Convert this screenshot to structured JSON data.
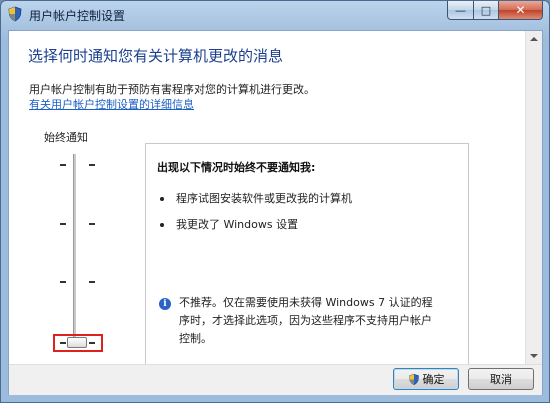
{
  "window": {
    "title": "用户帐户控制设置",
    "controls": {
      "minimize": "—",
      "maximize": "□",
      "close": "✕"
    }
  },
  "header": {
    "heading": "选择何时通知您有关计算机更改的消息",
    "description": "用户帐户控制有助于预防有害程序对您的计算机进行更改。",
    "link": "有关用户帐户控制设置的详细信息"
  },
  "slider": {
    "top_label": "始终通知",
    "level": 0,
    "levels_count": 4
  },
  "panel": {
    "title": "出现以下情况时始终不要通知我:",
    "bullets": [
      "程序试图安装软件或更改我的计算机",
      "我更改了 Windows 设置"
    ],
    "info_line1": "不推荐。仅在需要使用未获得 Windows 7 认证的程",
    "info_line2": "序时，才选择此选项，因为这些程序不支持用户帐户",
    "info_line3": "控制。"
  },
  "footer": {
    "ok_label": "确定",
    "cancel_label": "取消"
  },
  "icons": {
    "title_icon": "uac-shield-icon",
    "ok_icon": "uac-shield-icon",
    "info_icon": "info-icon"
  },
  "colors": {
    "heading": "#1a3f8f",
    "link": "#1c5fc4",
    "highlight": "#e02020"
  }
}
